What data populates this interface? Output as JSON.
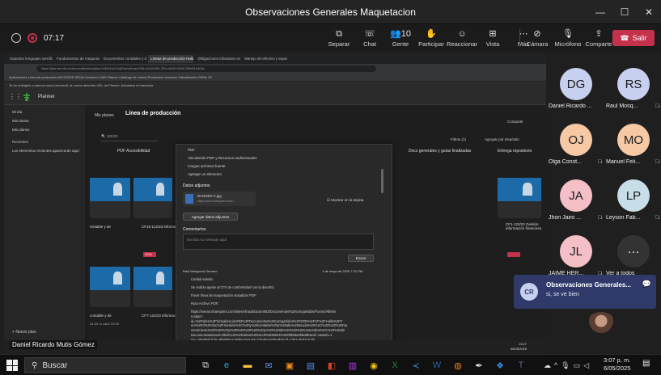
{
  "window": {
    "title": "Observaciones Generales Maquetacion",
    "controls": [
      "—",
      "☐",
      "✕"
    ]
  },
  "toolbar": {
    "elapsed": "07:17",
    "buttons": [
      {
        "icon": "share-icon",
        "glyph": "⧉",
        "label": "Separar"
      },
      {
        "icon": "chat-icon",
        "glyph": "☏",
        "label": "Chat"
      },
      {
        "icon": "people-icon",
        "glyph": "👥10",
        "label": "Gente"
      },
      {
        "icon": "raise-hand-icon",
        "glyph": "✋",
        "label": "Participar"
      },
      {
        "icon": "react-icon",
        "glyph": "☺",
        "label": "Reaccionar"
      },
      {
        "icon": "view-icon",
        "glyph": "⊞",
        "label": "Vista"
      },
      {
        "icon": "more-icon",
        "glyph": "⋯",
        "label": "Más"
      }
    ],
    "media": [
      {
        "icon": "camera-off-icon",
        "glyph": "⊘",
        "label": "Cámara"
      },
      {
        "icon": "mic-off-icon",
        "glyph": "🎙",
        "label": "Micrófono"
      },
      {
        "icon": "share-screen-icon",
        "glyph": "⇪",
        "label": "Comparte"
      }
    ],
    "leave_label": "Salir"
  },
  "browser": {
    "tabs": [
      "Soportes lenguajes sencilla",
      "Fundamentos de maquetacion",
      "Documentos contables y de la",
      "Líneas de producción Hulla 2025",
      "Obligaciones tributarias en el",
      "Manejo de efectivo y equivale"
    ],
    "address": "https://planner.cloud.microsoft/webui/plan/v0MJ4xa1UqZ/view/board?tid=cbc2c381-2f2e-4a93-91b5-33fe5f1bd00c",
    "bookmarks": "Aplicaciones   Línea de producción   ACCESOS SENA   Cuaderno   LMS Planner   Catálogo de cursos   Producción recursos   Virtualización   SENA   CF",
    "notice": "Te ha redirigido a planner.cloud.microsoft, la nueva dirección URL de Planner. Actualizar el marcador"
  },
  "planner": {
    "brand": "Planner",
    "sidebar": [
      "Mi día",
      "Mis tareas",
      "Mis planes"
    ],
    "section": "Recientes",
    "recent": "Los elementos recientes aparecerán aquí",
    "new_plan": "Nuevo plan",
    "crumb": "Mis planes",
    "plan_name": "Línea de producción",
    "search": "122/23",
    "columns": [
      "PDF Accesibilidad",
      "Docs generales y guías finalizadas",
      "Entrega repositorio"
    ],
    "filters": "Filtros (1)",
    "group": "Agrupar por Depósito",
    "share": "Compartir",
    "cards": [
      "CF16-122/23 información",
      "CF11-122/23 información",
      "CF1-122/23 Gestión información financiera",
      "CF7-122/23 información"
    ],
    "card_text": "rentable y de",
    "date_chip": "02/16",
    "bottom_text": "contable y de",
    "bottom_date": "01-04 ¾ Lab2 12:00"
  },
  "modal": {
    "options": [
      "PDF",
      "Vinculación PDF y Recursos audiovisuales",
      "Cargue archivos fuente",
      "Agregar un elemento"
    ],
    "attachments_header": "Datos adjuntos",
    "file_name": "BANNER 2.jpg",
    "file_url": "https://sena.sharepoint.com/...",
    "show_card": "Mostrar en la tarjeta",
    "add_attachments": "Agregar datos adjuntos",
    "comments_header": "Comentarios",
    "comment_placeholder": "Escriba su mensaje aquí",
    "send": "Enviar",
    "author": "Raúl Mosquera Serrano",
    "date": "1 de mayo de 2025 7:21 PM",
    "messages": [
      "Cordial saludo",
      "Se realiza ajuste al CTA de conformidad con la directriz.",
      "Favor línea de maquetación actualizar PDF",
      "Ruta Archivo PDF:",
      "https://sena4.sharepoint.com/sites/Virtualizacion802/Documentos%20compartidos/Forms/AllItem",
      "s.aspx?",
      "id=%2Fsites%2FVirtualizacion802%2FDocumentos%20compartidos%2F2025%2F1F%2FHulla%2FF",
      "em%2Fd%2Fdoc%2FGestión%2C%20y%20contable%20y%20abe%20deuda%20%2C%20%20%20ma",
      "ntenimiento%20%20%20y%20%20%20%20%20y%20%20de%20%20%20contenidos%2C%20%20de",
      "Documento&viewid=9bcfee15%2D4e5a%2D4ec9%2D96e3%2D0fd58a2b8a9b&csf=1&web=1",
      "&e=Ui5wkk0dCl0=9fe9b8a4-30d8-43a4-8ac7-fe48a7a8bc8b&cid=2481-0b07-0cd8",
      "006.4AAb8953f98849b5d2f96c97f14f306",
      "obormudez@sena.edu.co",
      "rjordeneh@sena.edu.co"
    ]
  },
  "inner_taskbar": {
    "presenter": "Daniel Ricardo Mutis Gómez",
    "time": "13:27",
    "date": "06/05/2025"
  },
  "participants": [
    {
      "initials": "DG",
      "name": "Daniel Ricardo ...",
      "color": "#c7d0ee",
      "muted": false
    },
    {
      "initials": "RS",
      "name": "Raul Mosq...",
      "color": "#c7d0ee",
      "muted": true
    },
    {
      "initials": "OJ",
      "name": "Olga Const...",
      "color": "#f6c8a4",
      "muted": true
    },
    {
      "initials": "MO",
      "name": "Manuel Feli...",
      "color": "#f6c8a4",
      "muted": true
    },
    {
      "initials": "JA",
      "name": "Jhon Jairo ...",
      "color": "#f4bfc7",
      "muted": true
    },
    {
      "initials": "LP",
      "name": "Leyson Fab...",
      "color": "#c7dde8",
      "muted": true
    },
    {
      "initials": "JL",
      "name": "JAIME HER...",
      "color": "#f4bfc7",
      "muted": true
    },
    {
      "initials": "···",
      "name": "Ver a todos",
      "color": "#333333",
      "muted": false
    }
  ],
  "chat_popup": {
    "initials": "CR",
    "title": "Observaciones Generales...",
    "message": "si, se ve bien"
  },
  "taskbar": {
    "search": "Buscar",
    "time": "3:07 p. m.",
    "date": "6/05/2025"
  }
}
